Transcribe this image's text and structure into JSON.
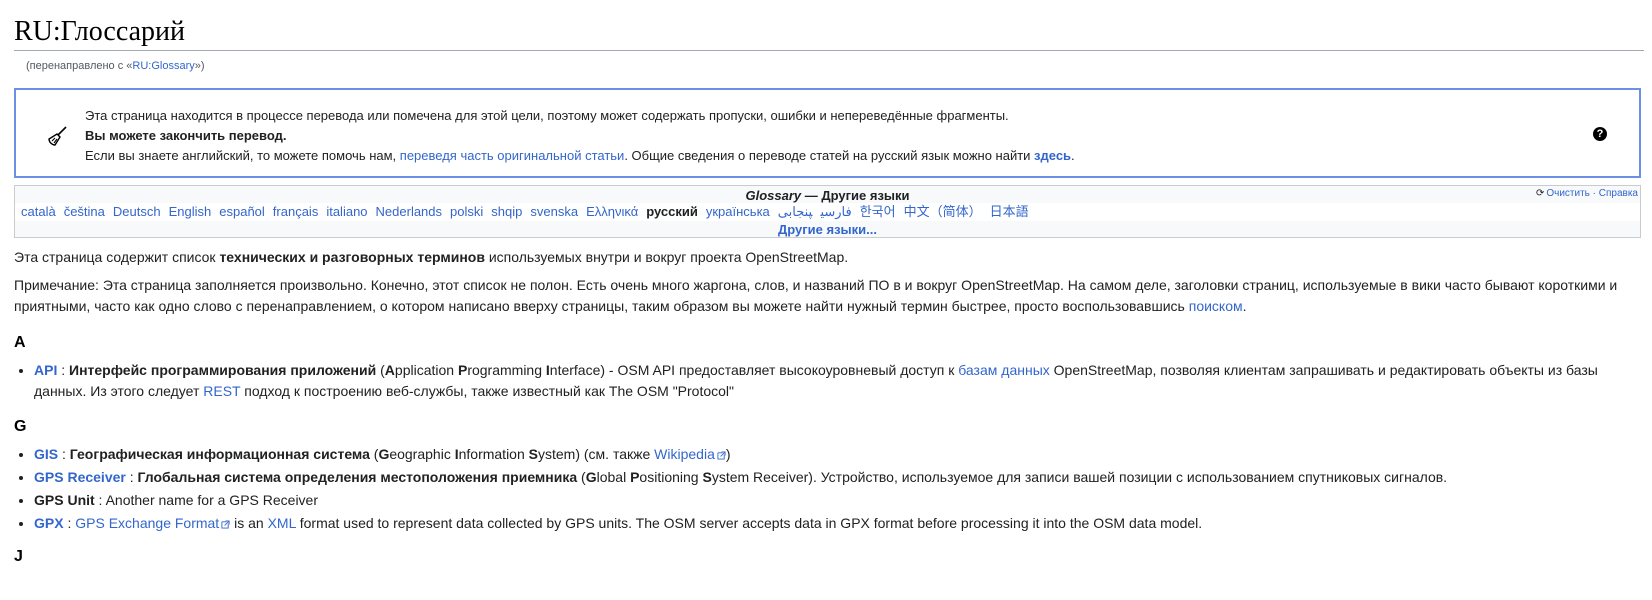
{
  "title": "RU:Глоссарий",
  "redirect": {
    "prefix": "(перенаправлено с «",
    "link": "RU:Glossary",
    "suffix": "»)"
  },
  "translation_box": {
    "line1": "Эта страница находится в процессе перевода или помечена для этой цели, поэтому может содержать пропуски, ошибки и непереведённые фрагменты.",
    "line2": "Вы можете закончить перевод.",
    "line3_prefix": "Если вы знаете английский, то можете помочь нам, ",
    "line3_link": "переведя часть оригинальной статьи",
    "line3_middle": ". Общие сведения о переводе статей на русский язык можно найти ",
    "line3_link2": "здесь",
    "line3_suffix": ".",
    "help": "?"
  },
  "language_bar": {
    "title_italic": "Glossary",
    "title_rest": " — Другие языки",
    "refresh_label": "Очистить",
    "separator": " · ",
    "help_label": "Справка",
    "languages": [
      "català",
      "čeština",
      "Deutsch",
      "English",
      "español",
      "français",
      "italiano",
      "Nederlands",
      "polski",
      "shqip",
      "svenska",
      "Ελληνικά",
      "русский",
      "українська",
      "فارسی",
      "پنجابی",
      "한국어",
      "中文（简体）",
      "日本語"
    ],
    "more": "Другие языки..."
  },
  "intro": {
    "prefix": "Эта страница содержит список ",
    "bold": "технических и разговорных терминов",
    "suffix": " используемых внутри и вокруг проекта OpenStreetMap."
  },
  "note": {
    "text": "Примечание: Эта страница заполняется произвольно. Конечно, этот список не полон. Есть очень много жаргона, слов, и названий ПО в и вокруг OpenStreetMap. На самом деле, заголовки страниц, используемые в вики часто бывают короткими и приятными, часто как одно слово с перенаправлением, о котором написано вверху страницы, таким образом вы можете найти нужный термин быстрее, просто воспользовавшись ",
    "link": "поиском",
    "suffix": "."
  },
  "sections": {
    "a": {
      "letter": "A",
      "api": {
        "name": "API",
        "sep": " : ",
        "bold": "Интерфейс программирования приложений",
        "t1": " (",
        "c1": "A",
        "r1": "pplication ",
        "c2": "P",
        "r2": "rogramming ",
        "c3": "I",
        "r3": "nterface) - OSM API предоставляет высокоуровневый доступ к ",
        "link1": "базам данных",
        "t2": " OpenStreetMap, позволяя клиентам запрашивать и редактировать объекты из базы данных. Из этого следует ",
        "link2": "REST",
        "t3": " подход к построению веб-службы, также известный как The OSM \"Protocol\""
      }
    },
    "g": {
      "letter": "G",
      "gis": {
        "name": "GIS",
        "sep": " : ",
        "bold": "Географическая информационная система",
        "t1": " (",
        "c1": "G",
        "r1": "eographic ",
        "c2": "I",
        "r2": "nformation ",
        "c3": "S",
        "r3": "ystem) (см. также ",
        "link": "Wikipedia",
        "t2": ")"
      },
      "gps_receiver": {
        "name": "GPS Receiver",
        "sep": " : ",
        "bold": "Глобальная система определения местоположения приемника",
        "t1": " (",
        "c1": "G",
        "r1": "lobal ",
        "c2": "P",
        "r2": "ositioning ",
        "c3": "S",
        "r3": "ystem Receiver). Устройство, используемое для записи вашей позиции с использованием спутниковых сигналов."
      },
      "gps_unit": {
        "name": "GPS Unit",
        "text": " : Another name for a GPS Receiver"
      },
      "gpx": {
        "name": "GPX",
        "sep": " : ",
        "link1": "GPS Exchange Format",
        "t1": " is an ",
        "link2": "XML",
        "t2": " format used to represent data collected by GPS units. The OSM server accepts data in GPX format before processing it into the OSM data model."
      }
    },
    "j": {
      "letter": "J"
    }
  },
  "colors": {
    "link": "#3366cc",
    "box_border": "#6d8fe6",
    "text": "#202122"
  }
}
